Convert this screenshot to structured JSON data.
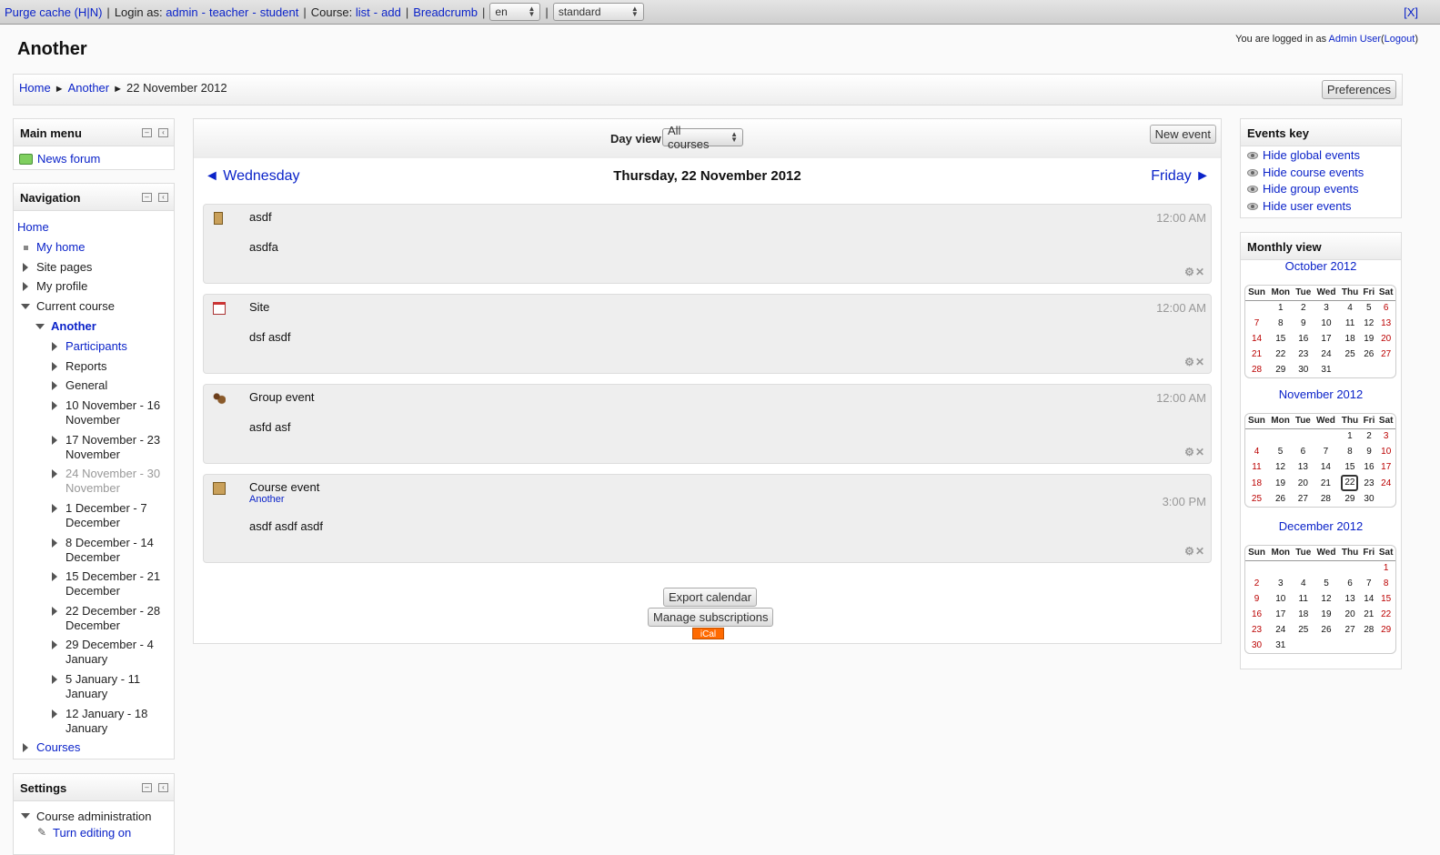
{
  "devbar": {
    "purge": "Purge cache (H|N)",
    "loginas": "Login as:",
    "admin": "admin",
    "teacher": "teacher",
    "student": "student",
    "dash": "-",
    "course": "Course:",
    "list": "list",
    "add": "add",
    "breadcrumb": "Breadcrumb",
    "lang": "en",
    "theme": "standard",
    "close": "[X]"
  },
  "header": {
    "title": "Another",
    "logged_prefix": "You are logged in as",
    "user": "Admin User",
    "logout": "Logout"
  },
  "breadcrumb": {
    "home": "Home",
    "course": "Another",
    "current": "22 November 2012",
    "preferences": "Preferences"
  },
  "main_menu": {
    "title": "Main menu",
    "item": "News forum"
  },
  "navigation": {
    "title": "Navigation",
    "items": [
      {
        "label": "Home",
        "type": "link",
        "indent": 0,
        "marker": "none"
      },
      {
        "label": "My home",
        "type": "link",
        "indent": 1,
        "marker": "square"
      },
      {
        "label": "Site pages",
        "type": "text",
        "indent": 1,
        "marker": "right"
      },
      {
        "label": "My profile",
        "type": "text",
        "indent": 1,
        "marker": "right"
      },
      {
        "label": "Current course",
        "type": "text",
        "indent": 1,
        "marker": "down"
      },
      {
        "label": "Another",
        "type": "bold-link",
        "indent": 2,
        "marker": "down"
      },
      {
        "label": "Participants",
        "type": "link",
        "indent": 3,
        "marker": "right"
      },
      {
        "label": "Reports",
        "type": "text",
        "indent": 3,
        "marker": "right"
      },
      {
        "label": "General",
        "type": "text",
        "indent": 3,
        "marker": "right"
      },
      {
        "label": "10 November - 16 November",
        "type": "text",
        "indent": 3,
        "marker": "right"
      },
      {
        "label": "17 November - 23 November",
        "type": "text",
        "indent": 3,
        "marker": "right"
      },
      {
        "label": "24 November - 30 November",
        "type": "dim",
        "indent": 3,
        "marker": "right"
      },
      {
        "label": "1 December - 7 December",
        "type": "text",
        "indent": 3,
        "marker": "right"
      },
      {
        "label": "8 December - 14 December",
        "type": "text",
        "indent": 3,
        "marker": "right"
      },
      {
        "label": "15 December - 21 December",
        "type": "text",
        "indent": 3,
        "marker": "right"
      },
      {
        "label": "22 December - 28 December",
        "type": "text",
        "indent": 3,
        "marker": "right"
      },
      {
        "label": "29 December - 4 January",
        "type": "text",
        "indent": 3,
        "marker": "right"
      },
      {
        "label": "5 January - 11 January",
        "type": "text",
        "indent": 3,
        "marker": "right"
      },
      {
        "label": "12 January - 18 January",
        "type": "text",
        "indent": 3,
        "marker": "right"
      },
      {
        "label": "Courses",
        "type": "link",
        "indent": 1,
        "marker": "right"
      }
    ]
  },
  "settings": {
    "title": "Settings",
    "course_admin": "Course administration",
    "turn_editing": "Turn editing on"
  },
  "calendar": {
    "view_label": "Day view",
    "course_filter": "All courses",
    "new_event": "New event",
    "prev": "◄ Wednesday",
    "next": "Friday ►",
    "day_title": "Thursday, 22 November 2012",
    "events": [
      {
        "name": "asdf",
        "course": "",
        "time": "12:00 AM",
        "description": "asdfa",
        "kind": "user",
        "color": "#dce5ec",
        "icon": "user-event-icon"
      },
      {
        "name": "Site",
        "course": "",
        "time": "12:00 AM",
        "description": "dsf asdf",
        "kind": "global",
        "color": "#d7f9cc",
        "icon": "calendar-icon"
      },
      {
        "name": "Group event",
        "course": "",
        "time": "12:00 AM",
        "description": "asfd asf",
        "kind": "group",
        "color": "#fde5b3",
        "icon": "group-icon"
      },
      {
        "name": "Course event",
        "course": "Another",
        "time": "3:00 PM",
        "description": "asdf asdf asdf",
        "kind": "course",
        "color": "#ffd3bd",
        "icon": "course-icon"
      }
    ],
    "export": "Export calendar",
    "manage": "Manage subscriptions",
    "ical": "iCal"
  },
  "events_key": {
    "title": "Events key",
    "items": [
      {
        "label": "Hide global events",
        "color": "#d7f9cc"
      },
      {
        "label": "Hide course events",
        "color": "#ffd3bd"
      },
      {
        "label": "Hide group events",
        "color": "#fde5b3"
      },
      {
        "label": "Hide user events",
        "color": "#dce5ec"
      }
    ]
  },
  "monthly": {
    "title": "Monthly view",
    "days": [
      "Sun",
      "Mon",
      "Tue",
      "Wed",
      "Thu",
      "Fri",
      "Sat"
    ],
    "months": [
      {
        "name": "October 2012",
        "weeks": [
          [
            "",
            "1",
            "2",
            "3",
            "4",
            "5",
            "6"
          ],
          [
            "7",
            "8",
            "9",
            "10",
            "11",
            "12",
            "13"
          ],
          [
            "14",
            "15",
            "16",
            "17",
            "18",
            "19",
            "20"
          ],
          [
            "21",
            "22",
            "23",
            "24",
            "25",
            "26",
            "27"
          ],
          [
            "28",
            "29",
            "30",
            "31",
            "",
            "",
            ""
          ]
        ]
      },
      {
        "name": "November 2012",
        "today": "22",
        "weeks": [
          [
            "",
            "",
            "",
            "",
            "1",
            "2",
            "3"
          ],
          [
            "4",
            "5",
            "6",
            "7",
            "8",
            "9",
            "10"
          ],
          [
            "11",
            "12",
            "13",
            "14",
            "15",
            "16",
            "17"
          ],
          [
            "18",
            "19",
            "20",
            "21",
            "22",
            "23",
            "24"
          ],
          [
            "25",
            "26",
            "27",
            "28",
            "29",
            "30",
            ""
          ]
        ]
      },
      {
        "name": "December 2012",
        "weeks": [
          [
            "",
            "",
            "",
            "",
            "",
            "",
            "1"
          ],
          [
            "2",
            "3",
            "4",
            "5",
            "6",
            "7",
            "8"
          ],
          [
            "9",
            "10",
            "11",
            "12",
            "13",
            "14",
            "15"
          ],
          [
            "16",
            "17",
            "18",
            "19",
            "20",
            "21",
            "22"
          ],
          [
            "23",
            "24",
            "25",
            "26",
            "27",
            "28",
            "29"
          ],
          [
            "30",
            "31",
            "",
            "",
            "",
            "",
            ""
          ]
        ]
      }
    ]
  }
}
